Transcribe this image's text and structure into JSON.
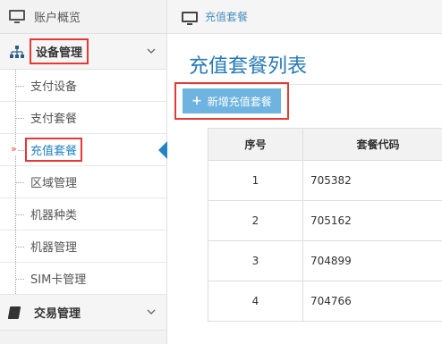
{
  "sidebar": {
    "top": {
      "label": "账户概览"
    },
    "groups": [
      {
        "label": "设备管理",
        "expanded": true
      },
      {
        "label": "交易管理",
        "expanded": false
      }
    ],
    "items": [
      {
        "label": "支付设备"
      },
      {
        "label": "支付套餐"
      },
      {
        "label": "充值套餐",
        "active": true
      },
      {
        "label": "区域管理"
      },
      {
        "label": "机器种类"
      },
      {
        "label": "机器管理"
      },
      {
        "label": "SIM卡管理"
      }
    ]
  },
  "breadcrumb": {
    "current": "充值套餐"
  },
  "page": {
    "title": "充值套餐列表",
    "add_button": "新增充值套餐"
  },
  "table": {
    "headers": [
      "序号",
      "套餐代码"
    ],
    "rows": [
      [
        "1",
        "705382"
      ],
      [
        "2",
        "705162"
      ],
      [
        "3",
        "704899"
      ],
      [
        "4",
        "704766"
      ]
    ]
  },
  "colors": {
    "accent": "#2283c5",
    "title": "#2679b5",
    "button": "#6fb3e0",
    "highlight": "#e53935"
  }
}
